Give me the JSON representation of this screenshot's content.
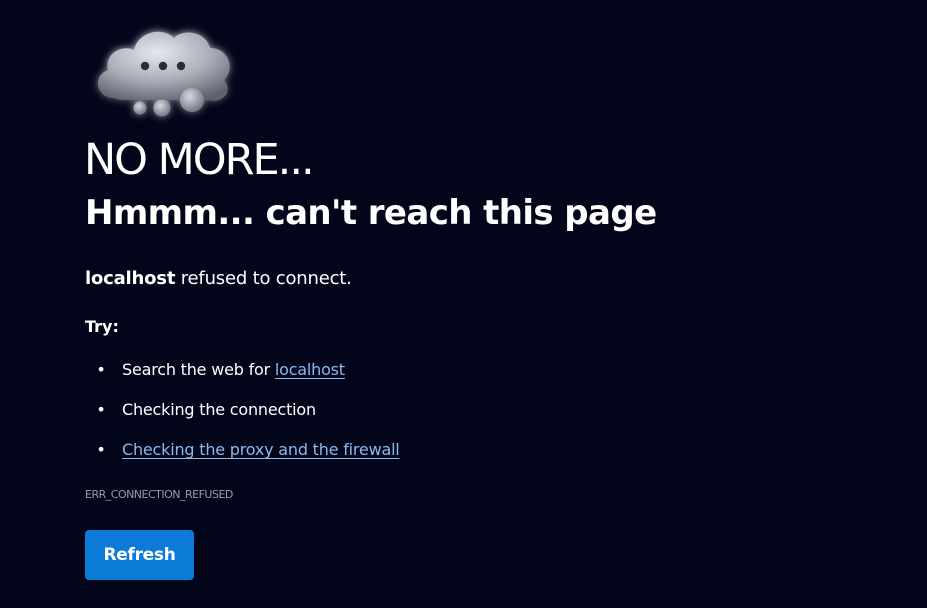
{
  "illustration": {
    "icon": "thinking-cloud-icon"
  },
  "brand_text": "NO MORE...",
  "error": {
    "title": "Hmmm... can't reach this page",
    "host": "localhost",
    "message": " refused to connect.",
    "try_label": "Try:",
    "suggestions": {
      "search_prefix": "Search the web for ",
      "search_link": "localhost",
      "check_connection": "Checking the connection",
      "check_proxy": "Checking the proxy and the firewall"
    },
    "code": "ERR_CONNECTION_REFUSED"
  },
  "actions": {
    "refresh_label": "Refresh"
  },
  "colors": {
    "background": "#03061a",
    "text": "#ffffff",
    "link": "#8bb8ee",
    "button": "#0c7ad7",
    "muted": "#9a9ba6"
  }
}
